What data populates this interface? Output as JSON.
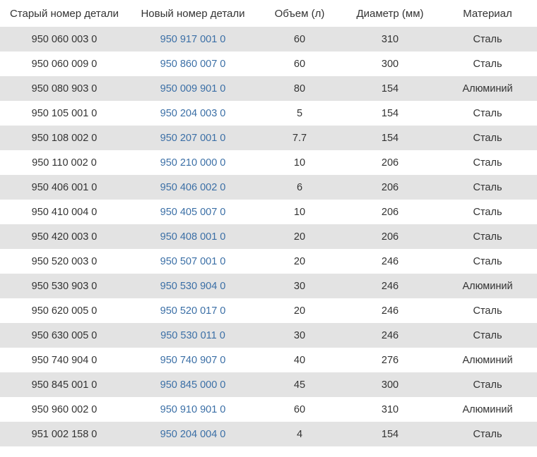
{
  "headers": [
    "Старый номер детали",
    "Новый номер детали",
    "Объем (л)",
    "Диаметр (мм)",
    "Материал"
  ],
  "rows": [
    {
      "old": "950 060 003 0",
      "new": "950 917 001 0",
      "volume": "60",
      "diameter": "310",
      "material": "Сталь"
    },
    {
      "old": "950 060 009 0",
      "new": "950 860 007 0",
      "volume": "60",
      "diameter": "300",
      "material": "Сталь"
    },
    {
      "old": "950 080 903 0",
      "new": "950 009 901 0",
      "volume": "80",
      "diameter": "154",
      "material": "Алюминий"
    },
    {
      "old": "950 105 001 0",
      "new": "950 204 003 0",
      "volume": "5",
      "diameter": "154",
      "material": "Сталь"
    },
    {
      "old": "950 108 002 0",
      "new": "950 207 001 0",
      "volume": "7.7",
      "diameter": "154",
      "material": "Сталь"
    },
    {
      "old": "950 110 002 0",
      "new": "950 210 000 0",
      "volume": "10",
      "diameter": "206",
      "material": "Сталь"
    },
    {
      "old": "950 406 001 0",
      "new": "950 406 002 0",
      "volume": "6",
      "diameter": "206",
      "material": "Сталь"
    },
    {
      "old": "950 410 004 0",
      "new": "950 405 007 0",
      "volume": "10",
      "diameter": "206",
      "material": "Сталь"
    },
    {
      "old": "950 420 003 0",
      "new": "950 408 001 0",
      "volume": "20",
      "diameter": "206",
      "material": "Сталь"
    },
    {
      "old": "950 520 003 0",
      "new": "950 507 001 0",
      "volume": "20",
      "diameter": "246",
      "material": "Сталь"
    },
    {
      "old": "950 530 903 0",
      "new": "950 530 904 0",
      "volume": "30",
      "diameter": "246",
      "material": "Алюминий"
    },
    {
      "old": "950 620 005 0",
      "new": "950 520 017 0",
      "volume": "20",
      "diameter": "246",
      "material": "Сталь"
    },
    {
      "old": "950 630 005 0",
      "new": "950 530 011 0",
      "volume": "30",
      "diameter": "246",
      "material": "Сталь"
    },
    {
      "old": "950 740 904 0",
      "new": "950 740 907 0",
      "volume": "40",
      "diameter": "276",
      "material": "Алюминий"
    },
    {
      "old": "950 845 001 0",
      "new": "950 845 000 0",
      "volume": "45",
      "diameter": "300",
      "material": "Сталь"
    },
    {
      "old": "950 960 002 0",
      "new": "950 910 901 0",
      "volume": "60",
      "diameter": "310",
      "material": "Алюминий"
    },
    {
      "old": "951 002 158 0",
      "new": "950 204 004 0",
      "volume": "4",
      "diameter": "154",
      "material": "Сталь"
    }
  ]
}
